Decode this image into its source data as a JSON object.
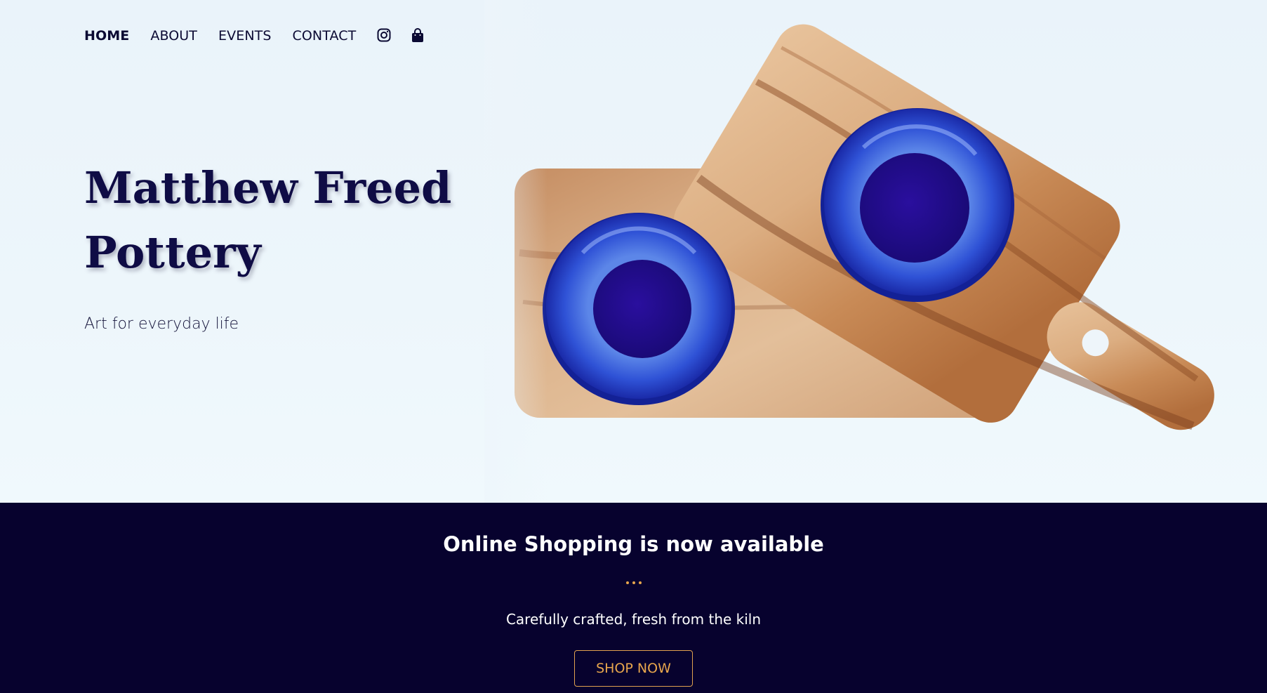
{
  "nav": {
    "items": [
      {
        "label": "HOME",
        "active": true
      },
      {
        "label": "ABOUT",
        "active": false
      },
      {
        "label": "EVENTS",
        "active": false
      },
      {
        "label": "CONTACT",
        "active": false
      }
    ],
    "icons": [
      "instagram-icon",
      "shopping-bag-icon"
    ]
  },
  "hero": {
    "title_line1": "Matthew Freed",
    "title_line2": "Pottery",
    "subtitle": "Art for everyday life",
    "image": "two-blue-ceramic-bowls-on-wooden-cutting-boards"
  },
  "promo": {
    "title": "Online Shopping is now available",
    "subtitle": "Carefully crafted, fresh from the kiln",
    "button_label": "SHOP NOW"
  },
  "colors": {
    "navy": "#07022e",
    "title": "#0f0c45",
    "accent": "#e8a64d",
    "bowl_blue": "#2e3fd0",
    "wood": "#c9946a"
  }
}
